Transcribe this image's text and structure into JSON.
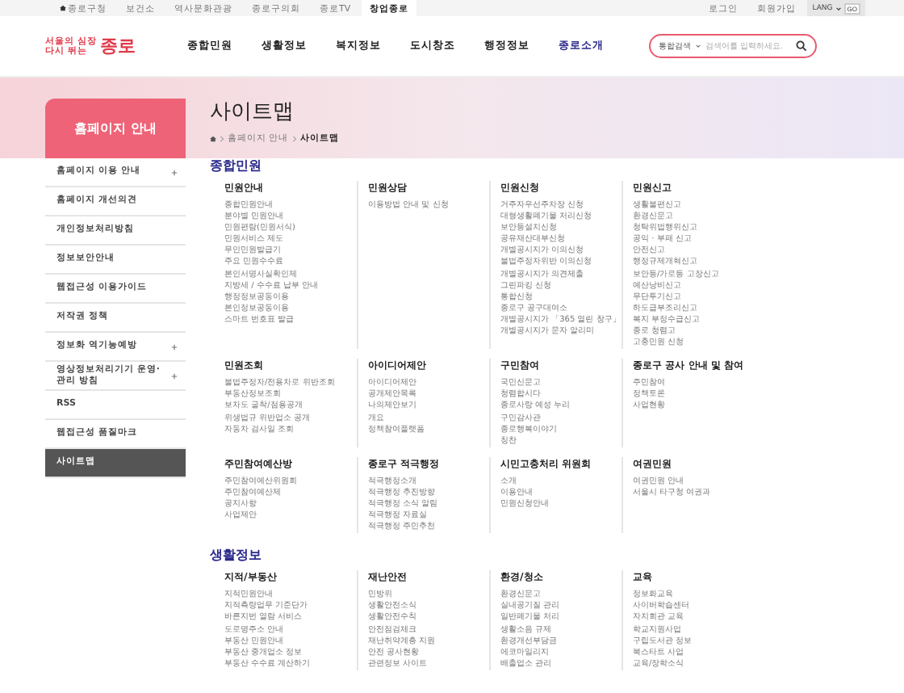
{
  "top_links": [
    {
      "label": "종로구청",
      "selected": false,
      "home": true
    },
    {
      "label": "보건소",
      "selected": false
    },
    {
      "label": "역사문화관광",
      "selected": false
    },
    {
      "label": "종로구의회",
      "selected": false
    },
    {
      "label": "종로TV",
      "selected": false
    },
    {
      "label": "창업종로",
      "selected": true
    }
  ],
  "account_links": [
    "로그인",
    "회원가입"
  ],
  "lang": {
    "label": "LANG",
    "button": "GO"
  },
  "logo": {
    "line1": "서울의 심장",
    "line2": "다시 뛰는",
    "name": "종로"
  },
  "nav": [
    {
      "label": "종합민원",
      "selected": false
    },
    {
      "label": "생활정보",
      "selected": false
    },
    {
      "label": "복지정보",
      "selected": false
    },
    {
      "label": "도시창조",
      "selected": false
    },
    {
      "label": "행정정보",
      "selected": false
    },
    {
      "label": "종로소개",
      "selected": true
    }
  ],
  "search": {
    "scope": "통합검색",
    "placeholder": "검색어를 입력하세요."
  },
  "sidebar": {
    "title": "홈페이지 안내",
    "items": [
      {
        "label": "홈페이지 이용 안내",
        "expandable": true,
        "selected": false
      },
      {
        "label": "홈페이지 개선의견",
        "expandable": false,
        "selected": false
      },
      {
        "label": "개인정보처리방침",
        "expandable": false,
        "selected": false
      },
      {
        "label": "정보보안안내",
        "expandable": false,
        "selected": false
      },
      {
        "label": "웹접근성 이용가이드",
        "expandable": false,
        "selected": false
      },
      {
        "label": "저작권 정책",
        "expandable": false,
        "selected": false
      },
      {
        "label": "정보화 역기능예방",
        "expandable": true,
        "selected": false
      },
      {
        "label": "영상정보처리기기 운영·관리 방침",
        "expandable": true,
        "selected": false
      },
      {
        "label": "RSS",
        "expandable": false,
        "selected": false
      },
      {
        "label": "웹접근성 품질마크",
        "expandable": false,
        "selected": false
      },
      {
        "label": "사이트맵",
        "expandable": false,
        "selected": true
      }
    ]
  },
  "page_title": "사이트맵",
  "breadcrumb": [
    "홈페이지 안내",
    "사이트맵"
  ],
  "sections": [
    {
      "title": "종합민원",
      "groups": [
        {
          "title": "민원안내",
          "items": [
            "종합민원안내",
            "분야별 민원안내",
            "민원편람(민원서식)",
            "민원서비스 제도",
            "무인민원발급기",
            "주요 민원수수료",
            "본인서명사실확인제",
            "지방세 / 수수료 납부 안내",
            "행정정보공동이용",
            "본인정보공동이용",
            "스마트 번호표 발급"
          ]
        },
        {
          "title": "민원상담",
          "items": [
            "이용방법 안내 및 신청"
          ]
        },
        {
          "title": "민원신청",
          "items": [
            "거주자우선주차장 신청",
            "대형생활폐기물 처리신청",
            "보안등설치신청",
            "공유재산대부신청",
            "개별공시지가 이의신청",
            "불법주정차위반 이의신청",
            "개별공시지가 의견제출",
            "그린파킹 신청",
            "통합신청",
            "종로구 공구대여소",
            "개별공시지가 「365 열린 창구」",
            "개별공시지가 문자 알리미"
          ]
        },
        {
          "title": "민원신고",
          "items": [
            "생활불편신고",
            "환경신문고",
            "청탁위법행위신고",
            "공익 · 부패 신고",
            "안전신고",
            "행정규제개혁신고",
            "보안등/가로등 고장신고",
            "예산낭비신고",
            "무단투기신고",
            "하도급부조리신고",
            "복지 부정수급신고",
            "종로 청렴고",
            "고충민원 신청"
          ]
        },
        {
          "title": "민원조회",
          "items": [
            "불법주정차/전용차로 위반조회",
            "부동산정보조회",
            "보차도 굴착/점용공개",
            "위생법규 위반업소 공개",
            "자동차 검사일 조회"
          ]
        },
        {
          "title": "아이디어제안",
          "items": [
            "아이디어제안",
            "공개제안목록",
            "나의제안보기",
            "개요",
            "정책참여플랫폼"
          ]
        },
        {
          "title": "구민참여",
          "items": [
            "국민신문고",
            "청렴합시다",
            "종로사랑 예성 누리",
            "구민감사관",
            "종로행복이야기",
            "칭찬"
          ]
        },
        {
          "title": "종로구 공사 안내 및 참여",
          "items": [
            "주민참여",
            "정책토론",
            "사업현황"
          ]
        },
        {
          "title": "주민참여예산방",
          "items": [
            "주민참여예산위원회",
            "주민참여예산제",
            "공지사항",
            "사업제안"
          ]
        },
        {
          "title": "종로구 적극행정",
          "items": [
            "적극행정소개",
            "적극행정 추진방향",
            "적극행정 소식 알림",
            "적극행정 자료실",
            "적극행정 주민추천"
          ]
        },
        {
          "title": "시민고충처리 위원회",
          "items": [
            "소개",
            "이용안내",
            "민원신청안내"
          ]
        },
        {
          "title": "여권민원",
          "items": [
            "여권민원 안내",
            "서울시 타구청 여권과"
          ]
        }
      ]
    },
    {
      "title": "생활정보",
      "groups": [
        {
          "title": "지적/부동산",
          "items": [
            "지적민원안내",
            "지적측량업무 기준단가",
            "바른지번 열람 서비스",
            "도로명주소 안내",
            "부동산 민원안내",
            "부동산 중개업소 정보",
            "부동산 수수료 계산하기"
          ]
        },
        {
          "title": "재난안전",
          "items": [
            "민방위",
            "생활안전소식",
            "생활안전수칙",
            "안전점검체크",
            "재난취약계층 지원",
            "안전 공사현황",
            "관련정보 사이트"
          ]
        },
        {
          "title": "환경/청소",
          "items": [
            "환경신문고",
            "실내공기질 관리",
            "일반폐기물 처리",
            "생활소음 규제",
            "환경개선부담금",
            "에코마일리지",
            "배출업소 관리"
          ]
        },
        {
          "title": "교육",
          "items": [
            "정보화교육",
            "사이버학습센터",
            "자치회관 교육",
            "학교지원사업",
            "구립도서관 정보",
            "북스타트 사업",
            "교육/장학소식"
          ]
        }
      ]
    }
  ]
}
